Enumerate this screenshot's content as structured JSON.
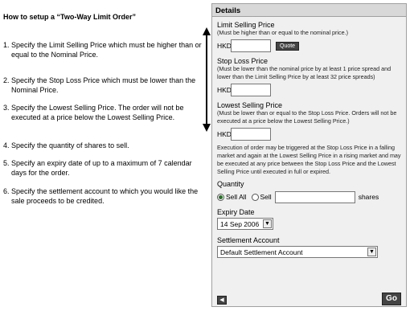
{
  "instructions": {
    "title": "How to setup a “Two-Way Limit Order”",
    "steps": [
      {
        "num": "1.",
        "text": "Specify the Limit Selling Price which must be higher than or equal to the Nominal Price."
      },
      {
        "num": "2.",
        "text": "Specify the Stop Loss Price which must be lower than the Nominal Price."
      },
      {
        "num": "3.",
        "text": "Specify the Lowest Selling Price. The order will not be executed at a price below the Lowest Selling Price."
      },
      {
        "num": "4.",
        "text": "Specify the quantity of shares to sell."
      },
      {
        "num": "5.",
        "text": "Specify an expiry date of up to a maximum of 7 calendar days for the order."
      },
      {
        "num": "6.",
        "text": "Specify the settlement account to which you would like the sale proceeds to be credited."
      }
    ]
  },
  "panel": {
    "header": "Details",
    "limit": {
      "title": "Limit Selling Price",
      "note": "(Must be higher than or equal to the nominal price.)",
      "ccy": "HKD",
      "value": "",
      "quote_label": "Quote"
    },
    "stop": {
      "title": "Stop Loss Price",
      "note": "(Must be lower than the nominal price by at least 1 price spread and lower than the Limit Selling Price by at least 32 price spreads)",
      "ccy": "HKD",
      "value": ""
    },
    "lowest": {
      "title": "Lowest Selling Price",
      "note": "(Must be lower than or equal to the Stop Loss Price. Orders will not be executed at a price below the Lowest Selling Price.)",
      "ccy": "HKD",
      "value": ""
    },
    "exec_note": "Execution of order may be triggered at the Stop Loss Price in a falling market and again at the Lowest Selling Price in a rising market and may be executed at any price between the Stop Loss Price and the Lowest Selling Price until executed in full or expired.",
    "quantity": {
      "title": "Quantity",
      "sell_all": "Sell All",
      "sell": "Sell",
      "shares": "shares",
      "selected": "sell_all"
    },
    "expiry": {
      "title": "Expiry Date",
      "value": "14 Sep 2006"
    },
    "settlement": {
      "title": "Settlement Account",
      "value": "Default Settlement Account"
    },
    "go_label": "Go"
  },
  "colors": {
    "panel_bg": "#f0f0f0",
    "header_bg": "#d8d8d8",
    "button_bg": "#444444",
    "radio_selected": "#2a6b2a"
  }
}
